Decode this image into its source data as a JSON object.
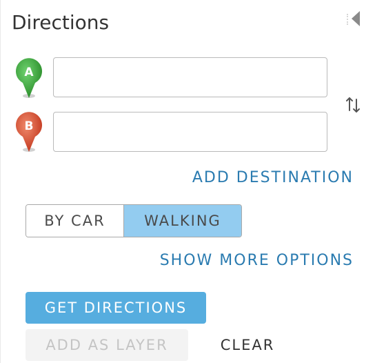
{
  "panel": {
    "title": "Directions",
    "collapse_icon": "chevron-left-icon"
  },
  "stops": [
    {
      "marker_label": "A",
      "marker_color": "#3a9f3a",
      "value": "",
      "placeholder": ""
    },
    {
      "marker_label": "B",
      "marker_color": "#d4442a",
      "value": "",
      "placeholder": ""
    }
  ],
  "swap_icon": "swap-vertical-icon",
  "add_destination_label": "ADD DESTINATION",
  "travel_mode": {
    "options": [
      "BY CAR",
      "WALKING"
    ],
    "selected": "WALKING"
  },
  "show_more_options_label": "SHOW MORE OPTIONS",
  "actions": {
    "get_directions_label": "GET DIRECTIONS",
    "add_as_layer_label": "ADD AS LAYER",
    "add_as_layer_disabled": true,
    "clear_label": "CLEAR"
  },
  "colors": {
    "accent_link": "#2a7bb0",
    "primary_button": "#56addf",
    "selected_mode": "#93ccf0"
  }
}
